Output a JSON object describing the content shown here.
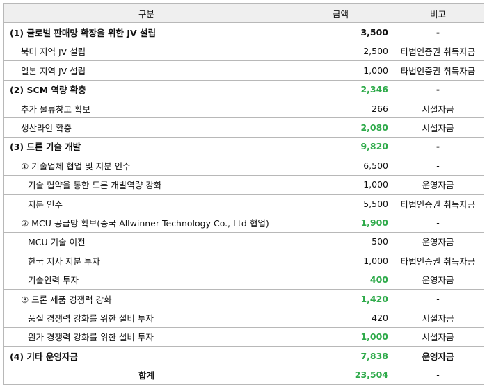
{
  "table": {
    "headers": {
      "name": "구분",
      "amount": "금액",
      "note": "비고"
    },
    "rows": [
      {
        "name": "(1) 글로벌 판매망 확장을 위한 JV 설립",
        "amount": "3,500",
        "note": "-",
        "level": 1,
        "bold": true,
        "green": false
      },
      {
        "name": "북미 지역 JV 설립",
        "amount": "2,500",
        "note": "타법인증권 취득자금",
        "level": 2,
        "bold": false,
        "green": false
      },
      {
        "name": "일본 지역 JV 설립",
        "amount": "1,000",
        "note": "타법인증권 취득자금",
        "level": 2,
        "bold": false,
        "green": false
      },
      {
        "name": "(2) SCM 역량 확충",
        "amount": "2,346",
        "note": "-",
        "level": 1,
        "bold": true,
        "green": true
      },
      {
        "name": "추가 물류창고 확보",
        "amount": "266",
        "note": "시설자금",
        "level": 2,
        "bold": false,
        "green": false
      },
      {
        "name": "생산라인 확충",
        "amount": "2,080",
        "note": "시설자금",
        "level": 2,
        "bold": false,
        "green": true
      },
      {
        "name": "(3) 드론 기술 개발",
        "amount": "9,820",
        "note": "-",
        "level": 1,
        "bold": true,
        "green": true
      },
      {
        "name": "① 기술업체 협업 및 지분 인수",
        "amount": "6,500",
        "note": "-",
        "level": 2,
        "bold": false,
        "green": false
      },
      {
        "name": "기술 협약을 통한 드론 개발역량 강화",
        "amount": "1,000",
        "note": "운영자금",
        "level": 3,
        "bold": false,
        "green": false
      },
      {
        "name": "지분 인수",
        "amount": "5,500",
        "note": "타법인증권 취득자금",
        "level": 3,
        "bold": false,
        "green": false
      },
      {
        "name": "② MCU 공급망 확보(중국 Allwinner Technology Co., Ltd 협업)",
        "amount": "1,900",
        "note": "-",
        "level": 2,
        "bold": false,
        "green": true
      },
      {
        "name": "MCU 기술 이전",
        "amount": "500",
        "note": "운영자금",
        "level": 3,
        "bold": false,
        "green": false
      },
      {
        "name": "한국 지사 지분 투자",
        "amount": "1,000",
        "note": "타법인증권 취득자금",
        "level": 3,
        "bold": false,
        "green": false
      },
      {
        "name": "기술인력 투자",
        "amount": "400",
        "note": "운영자금",
        "level": 3,
        "bold": false,
        "green": true
      },
      {
        "name": "③ 드론 제품 경쟁력 강화",
        "amount": "1,420",
        "note": "-",
        "level": 2,
        "bold": false,
        "green": true
      },
      {
        "name": "품질 경쟁력 강화를 위한 설비 투자",
        "amount": "420",
        "note": "시설자금",
        "level": 3,
        "bold": false,
        "green": false
      },
      {
        "name": "원가 경쟁력 강화를 위한 설비 투자",
        "amount": "1,000",
        "note": "시설자금",
        "level": 3,
        "bold": false,
        "green": true
      },
      {
        "name": "(4) 기타 운영자금",
        "amount": "7,838",
        "note": "운영자금",
        "level": 1,
        "bold": true,
        "green": true
      }
    ],
    "total": {
      "name": "합계",
      "amount": "23,504",
      "note": "-"
    }
  }
}
